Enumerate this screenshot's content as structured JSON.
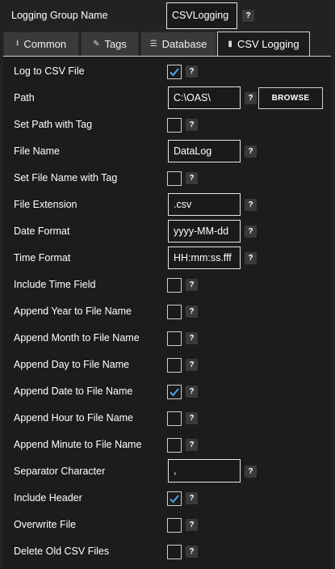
{
  "header": {
    "group_label": "Logging Group Name",
    "group_value": "CSVLogging",
    "help": "?"
  },
  "tabs": [
    {
      "label": "Common",
      "icon": "download-icon",
      "glyph": "⭳",
      "active": false
    },
    {
      "label": "Tags",
      "icon": "tag-icon",
      "glyph": "✎",
      "active": false
    },
    {
      "label": "Database",
      "icon": "database-icon",
      "glyph": "☰",
      "active": false
    },
    {
      "label": "CSV Logging",
      "icon": "book-icon",
      "glyph": "▮",
      "active": true
    }
  ],
  "fields": {
    "log_to_csv": {
      "label": "Log to CSV File",
      "checked": true
    },
    "path": {
      "label": "Path",
      "value": "C:\\OAS\\"
    },
    "browse": {
      "label": "BROWSE"
    },
    "set_path_with_tag": {
      "label": "Set Path with Tag",
      "checked": false
    },
    "file_name": {
      "label": "File Name",
      "value": "DataLog"
    },
    "set_file_name_with_tag": {
      "label": "Set File Name with Tag",
      "checked": false
    },
    "file_extension": {
      "label": "File Extension",
      "value": ".csv"
    },
    "date_format": {
      "label": "Date Format",
      "value": "yyyy-MM-dd"
    },
    "time_format": {
      "label": "Time Format",
      "value": "HH:mm:ss.fff"
    },
    "include_time_field": {
      "label": "Include Time Field",
      "checked": false
    },
    "append_year": {
      "label": "Append Year to File Name",
      "checked": false
    },
    "append_month": {
      "label": "Append Month to File Name",
      "checked": false
    },
    "append_day": {
      "label": "Append Day to File Name",
      "checked": false
    },
    "append_date": {
      "label": "Append Date to File Name",
      "checked": true
    },
    "append_hour": {
      "label": "Append Hour to File Name",
      "checked": false
    },
    "append_minute": {
      "label": "Append Minute to File Name",
      "checked": false
    },
    "separator": {
      "label": "Separator Character",
      "value": ","
    },
    "include_header": {
      "label": "Include Header",
      "checked": true
    },
    "overwrite_file": {
      "label": "Overwrite File",
      "checked": false
    },
    "delete_old_csv": {
      "label": "Delete Old CSV Files",
      "checked": false
    }
  },
  "colors": {
    "background": "#222222",
    "panel": "#1c1c1c",
    "check_color": "#4aa3df"
  }
}
